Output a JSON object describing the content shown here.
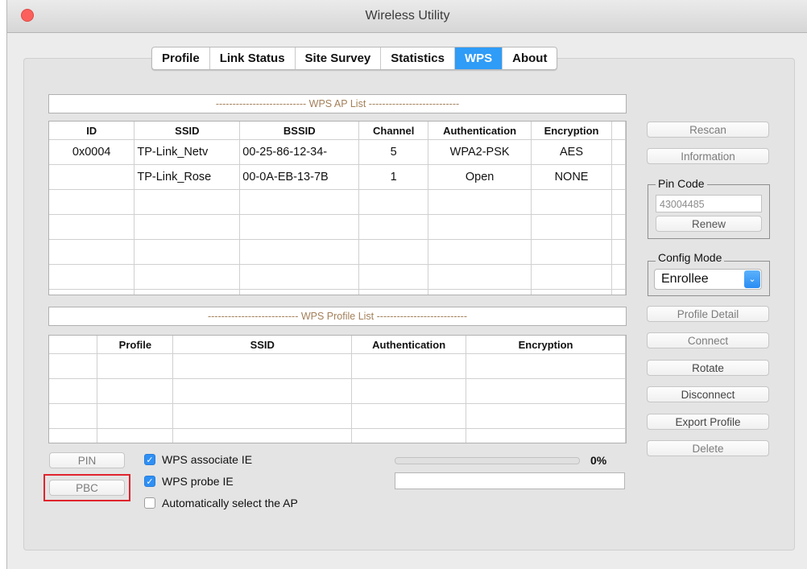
{
  "window": {
    "title": "Wireless Utility"
  },
  "tabs": [
    {
      "label": "Profile",
      "active": false
    },
    {
      "label": "Link Status",
      "active": false
    },
    {
      "label": "Site Survey",
      "active": false
    },
    {
      "label": "Statistics",
      "active": false
    },
    {
      "label": "WPS",
      "active": true
    },
    {
      "label": "About",
      "active": false
    }
  ],
  "ap_list": {
    "header": "--------------------------- WPS AP List ---------------------------",
    "columns": [
      "ID",
      "SSID",
      "BSSID",
      "Channel",
      "Authentication",
      "Encryption"
    ],
    "rows": [
      [
        "0x0004",
        "TP-Link_Netv",
        "00-25-86-12-34-",
        "5",
        "WPA2-PSK",
        "AES"
      ],
      [
        "",
        "TP-Link_Rose",
        "00-0A-EB-13-7B",
        "1",
        "Open",
        "NONE"
      ]
    ]
  },
  "profile_list": {
    "header": "--------------------------- WPS Profile List ---------------------------",
    "columns": [
      "",
      "Profile",
      "SSID",
      "Authentication",
      "Encryption"
    ]
  },
  "buttons": {
    "rescan": "Rescan",
    "information": "Information",
    "renew": "Renew",
    "profile_detail": "Profile Detail",
    "connect": "Connect",
    "rotate": "Rotate",
    "disconnect": "Disconnect",
    "export_profile": "Export Profile",
    "delete": "Delete",
    "pin": "PIN",
    "pbc": "PBC"
  },
  "pin_code": {
    "label": "Pin Code",
    "value": "43004485"
  },
  "config_mode": {
    "label": "Config Mode",
    "selected": "Enrollee"
  },
  "options": {
    "wps_associate_ie": {
      "label": "WPS associate IE",
      "checked": true
    },
    "wps_probe_ie": {
      "label": "WPS probe IE",
      "checked": true
    },
    "auto_select_ap": {
      "label": "Automatically select the AP",
      "checked": false
    }
  },
  "progress": {
    "value": 0,
    "label": "0%"
  },
  "status_text": "",
  "colors": {
    "accent": "#2f9cf7",
    "highlight": "#e0242d",
    "section_header_text": "#a4805a"
  }
}
